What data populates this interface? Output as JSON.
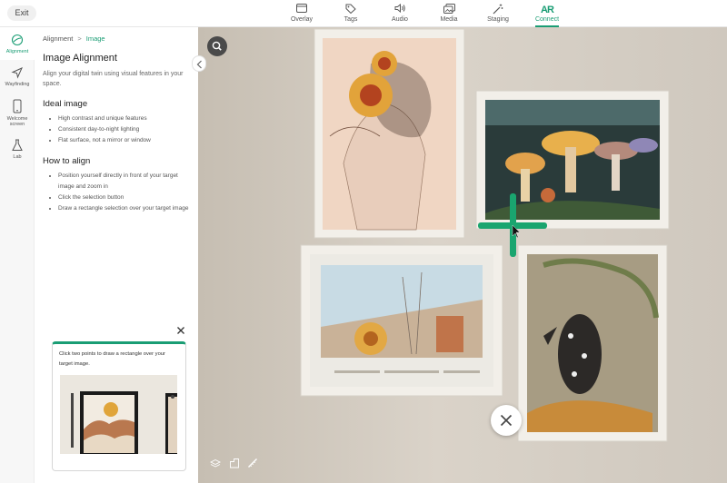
{
  "header": {
    "exit_label": "Exit",
    "tabs": [
      {
        "label": "Overlay",
        "icon": "overlay-icon"
      },
      {
        "label": "Tags",
        "icon": "tag-icon"
      },
      {
        "label": "Audio",
        "icon": "speaker-icon"
      },
      {
        "label": "Media",
        "icon": "media-icon"
      },
      {
        "label": "Staging",
        "icon": "magic-wand-icon"
      },
      {
        "label": "Connect",
        "icon": "ar-icon",
        "logo_text": "AR",
        "active": true
      }
    ]
  },
  "rail": {
    "items": [
      {
        "label": "Alignment",
        "icon": "alignment-icon",
        "active": true
      },
      {
        "label": "Wayfinding",
        "icon": "navigation-arrow-icon"
      },
      {
        "label": "Welcome screen",
        "icon": "phone-icon"
      },
      {
        "label": "Lab",
        "icon": "flask-icon"
      }
    ]
  },
  "panel": {
    "breadcrumb": {
      "parent": "Alignment",
      "separator": ">",
      "current": "Image"
    },
    "title": "Image Alignment",
    "description": "Align your digital twin using visual features in your space.",
    "ideal_heading": "Ideal image",
    "ideal_items": [
      "High contrast and unique features",
      "Consistent day-to-night lighting",
      "Flat surface, not a mirror or window"
    ],
    "how_heading": "How to align",
    "how_items": [
      "Position yourself directly in front of your target image and zoom in",
      "Click the selection button",
      "Draw a rectangle selection over your target image"
    ]
  },
  "hint": {
    "text": "Click two points to draw a rectangle over your target image."
  },
  "colors": {
    "accent": "#1a9d74",
    "crosshair": "#1aa56f"
  }
}
